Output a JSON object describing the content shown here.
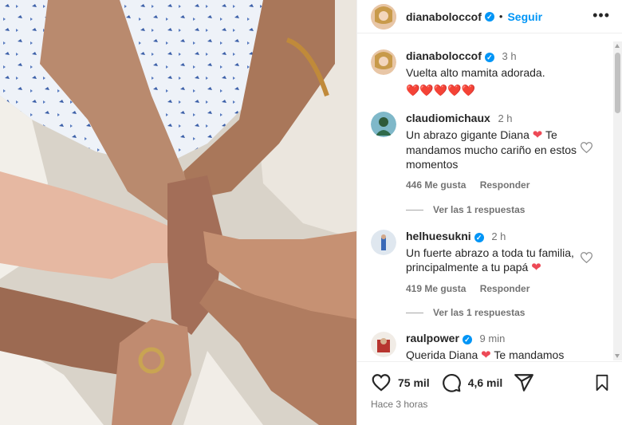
{
  "post": {
    "author": "dianaboloccof",
    "follow_label": "Seguir",
    "more_label": "•••",
    "posted_ago": "Hace 3 horas"
  },
  "caption": {
    "user": "dianaboloccof",
    "time": "3 h",
    "text": "Vuelta alto mamita adorada.",
    "hearts": "❤️❤️❤️❤️❤️"
  },
  "comments": [
    {
      "user": "claudiomichaux",
      "time": "2 h",
      "text_a": "Un abrazo gigante Diana",
      "text_b": "Te mandamos mucho cariño en estos momentos",
      "likes": "446 Me gusta",
      "reply_label": "Responder",
      "view_replies": "Ver las 1 respuestas"
    },
    {
      "user": "helhuesukni",
      "time": "2 h",
      "text_a": "Un fuerte abrazo a toda tu familia, principalmente a tu papá",
      "likes": "419 Me gusta",
      "reply_label": "Responder",
      "view_replies": "Ver las 1 respuestas"
    },
    {
      "user": "raulpower",
      "time": "9 min",
      "text_a": "Querida Diana",
      "text_b": "Te mandamos"
    }
  ],
  "actions": {
    "likes_count": "75 mil",
    "comments_count": "4,6 mil"
  },
  "icons": {
    "heart": "heart-icon",
    "comment": "comment-icon",
    "share": "share-icon",
    "bookmark": "bookmark-icon"
  },
  "colors": {
    "accent": "#0095f6",
    "heart": "#ed4956",
    "muted": "#737373"
  }
}
